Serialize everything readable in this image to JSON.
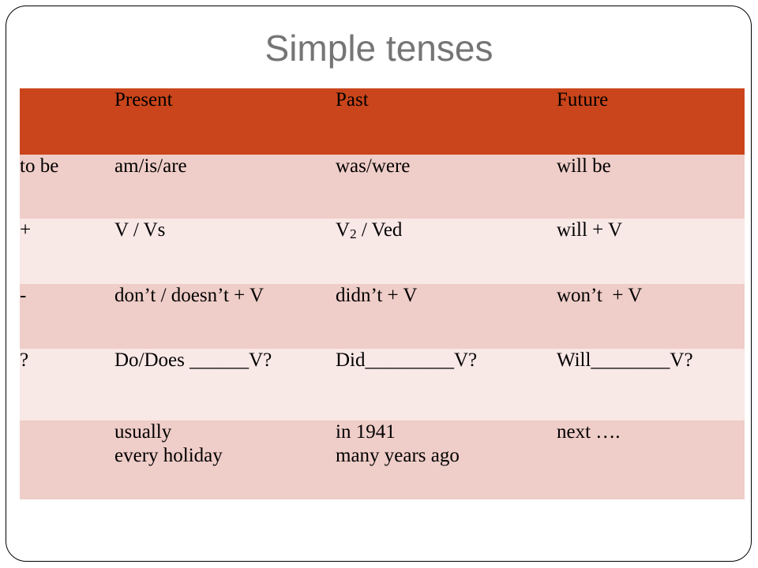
{
  "slide": {
    "title": "Simple tenses",
    "title_color": "#757575",
    "frame_color": "#000000",
    "background": "#ffffff"
  },
  "table": {
    "header_bg": "#CA451B",
    "header_text_color": "#ffffff",
    "row_bg_dark": "#EFCDC8",
    "row_bg_light": "#F8E8E6",
    "columns": {
      "label": "",
      "present": "Present",
      "past": "Past",
      "future": "Future"
    },
    "rows": [
      {
        "label": "to be",
        "present": "am/is/are",
        "past": "was/were",
        "future": "will be"
      },
      {
        "label": "+",
        "present": "V / Vs",
        "past_prefix": "V",
        "past_subscript": "2",
        "past_suffix": " / Ved",
        "past": "V2 / Ved",
        "future": "will + V"
      },
      {
        "label": "-",
        "present": "don’t / doesn’t + V",
        "past": "didn’t + V",
        "future": "won’t  + V"
      },
      {
        "label": "?",
        "present": "Do/Does ______V?",
        "past": "Did_________V?",
        "future": "Will________V?"
      },
      {
        "label": "",
        "present_line1": "usually",
        "present_line2": "every holiday",
        "past_line1": "in 1941",
        "past_line2": "many years ago",
        "future_line1": "next ….",
        "future_line2": ""
      }
    ]
  }
}
